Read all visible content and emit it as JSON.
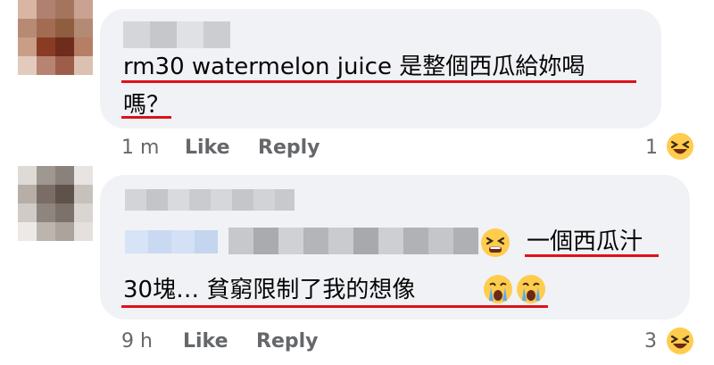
{
  "comments": [
    {
      "text_line1": "rm30 watermelon juice 是整個西瓜給妳喝",
      "text_line2": "嗎？",
      "time": "1 m",
      "like": "Like",
      "reply": "Reply",
      "reaction_count": "1",
      "reaction_icon": "laughing-emoji-icon"
    },
    {
      "text_line1": "一個西瓜汁",
      "text_line2": "30塊… 貧窮限制了我的想像",
      "time": "9 h",
      "like": "Like",
      "reply": "Reply",
      "reaction_count": "3",
      "reaction_icon": "laughing-emoji-icon"
    }
  ],
  "colors": {
    "bubble": "#f0f2f5",
    "underline": "#e0101a",
    "meta": "#65676b",
    "emoji_yellow": "#ffcc4d"
  }
}
